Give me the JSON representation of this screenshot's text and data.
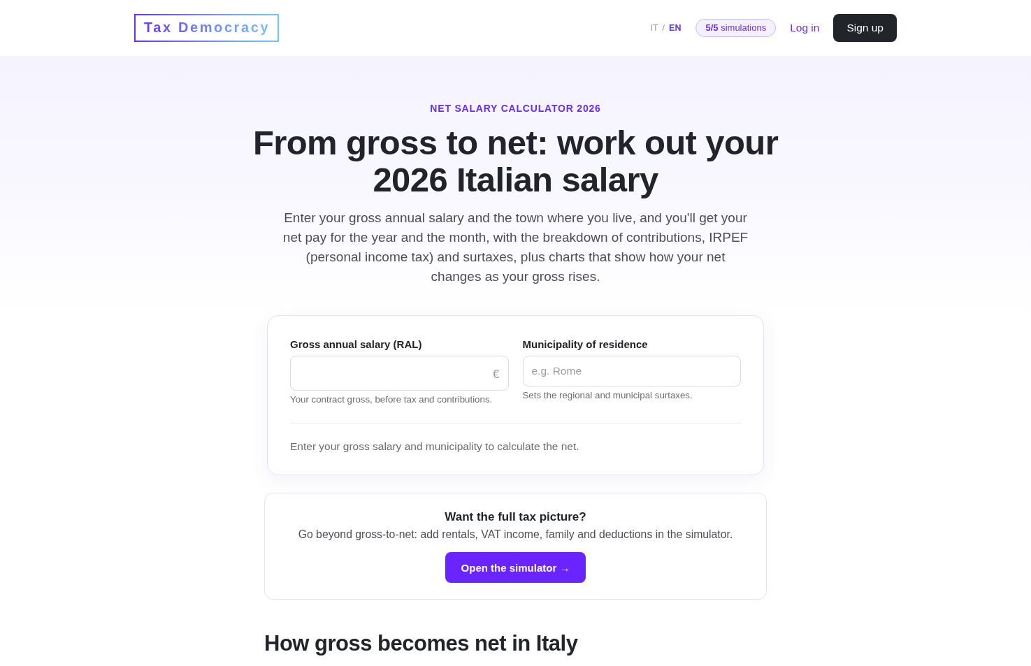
{
  "header": {
    "logo": "Tax Democracy",
    "languages": [
      {
        "label": "IT",
        "selected": false
      },
      {
        "label": "EN",
        "selected": true
      }
    ],
    "language_separator": "/",
    "simulations_badge": "**5/5** simulations",
    "login_link": "Log in",
    "signup_button": "Sign up"
  },
  "hero": {
    "eyebrow": "NET SALARY CALCULATOR 2026",
    "title": "From gross to net: work out your 2026 Italian salary",
    "description": "Enter your gross annual salary and the town where you live, and you'll get your net pay for the year and the month, with the breakdown of contributions, IRPEF (personal income tax) and surtaxes, plus charts that show how your net changes as your gross rises."
  },
  "calculator": {
    "fields": [
      {
        "kind": "amount",
        "label": "Gross annual salary (RAL)",
        "suffix": "€",
        "hint": "Your contract gross, before tax and contributions."
      },
      {
        "kind": "text",
        "label": "Municipality of residence",
        "placeholder": "e.g. Rome",
        "hint": "Sets the regional and municipal surtaxes."
      }
    ],
    "status": "Enter your gross salary and municipality to calculate the net."
  },
  "promo": {
    "title": "Want the full tax picture?",
    "description": "Go beyond gross-to-net: add rentals, VAT income, family and deductions in the simulator.",
    "button": "Open the simulator →"
  },
  "section_heading": "How gross becomes net in Italy"
}
